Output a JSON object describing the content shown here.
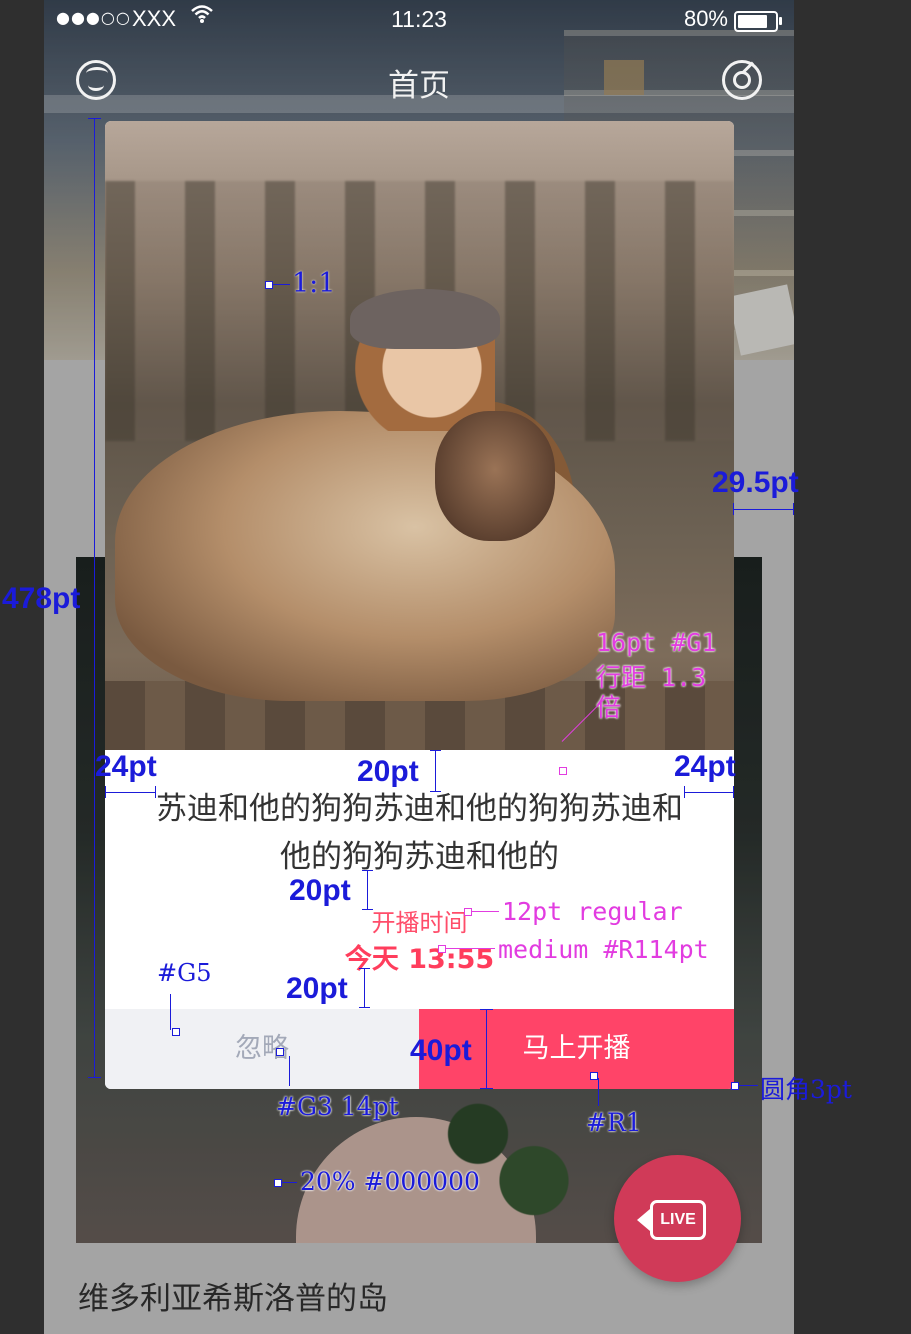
{
  "status_bar": {
    "signal_dots": "●●●○○",
    "carrier": "XXX",
    "time": "11:23",
    "battery_pct": "80%",
    "battery_level": 0.8
  },
  "nav": {
    "title": "首页",
    "left_icon": "smiley-face-icon",
    "right_icon": "radar-icon"
  },
  "modal": {
    "description_line1": "苏迪和他的狗狗苏迪和他的狗狗苏迪和",
    "description_line2": "他的狗狗苏迪和他的",
    "start_time_label": "开播时间",
    "start_time_value": "今天 13:55",
    "ignore_button": "忽略",
    "start_button": "马上开播"
  },
  "card": {
    "title": "维多利亚希斯洛普的岛"
  },
  "live_button": {
    "label": "LIVE",
    "icon": "live-camera-icon"
  },
  "annotations": {
    "modal_height": "478pt",
    "ratio": "1:1",
    "right_margin": "29.5pt",
    "font_note_1": "16pt #G1",
    "font_note_2": "行距 1.3",
    "font_note_3": "倍",
    "padding_left": "24pt",
    "padding_right": "24pt",
    "gap_top": "20pt",
    "gap_mid": "20pt",
    "gap_bottom": "20pt",
    "label_style": "12pt regular",
    "time_style": "medium #R114pt",
    "ignore_bg": "#G5",
    "button_height": "40pt",
    "corner_radius": "圆角3pt",
    "ignore_text_style": "#G3 14pt",
    "start_bg": "#R1",
    "mask": "20% #000000"
  },
  "colors": {
    "accent_red": "#ff4468",
    "ignore_bg": "#f0f1f4",
    "ignore_text": "#a3a9b8",
    "body_text": "#333333",
    "annotation_blue": "#1b1bd9",
    "annotation_magenta": "#e23ce0"
  }
}
